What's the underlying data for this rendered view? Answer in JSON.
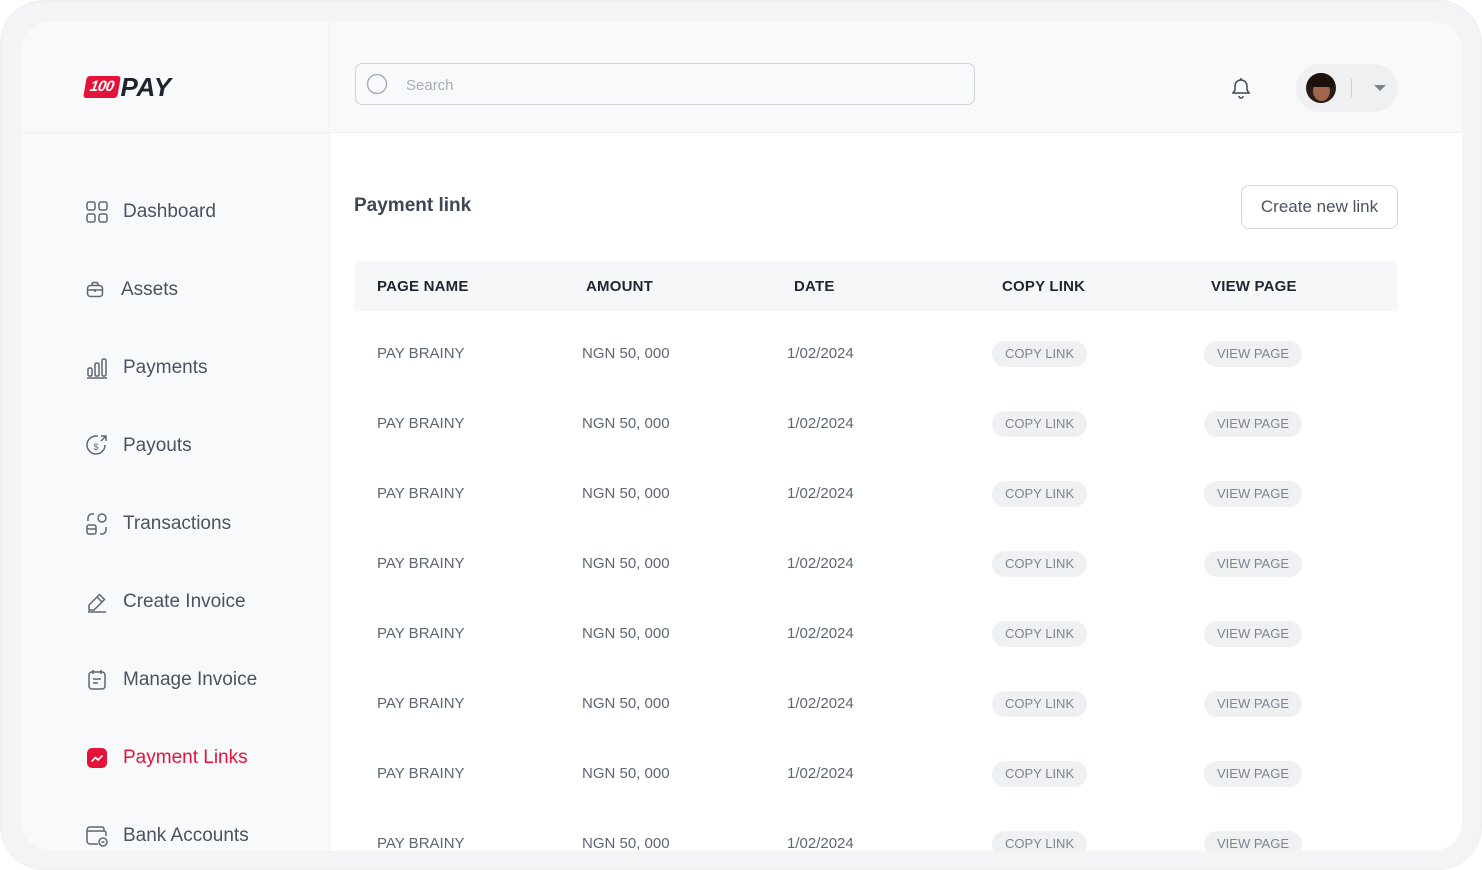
{
  "brand": {
    "badge": "100",
    "name": "PAY",
    "accent": "#e5133a"
  },
  "search": {
    "placeholder": "Search",
    "value": ""
  },
  "sidebar": {
    "items": [
      {
        "label": "Dashboard",
        "icon": "grid-icon",
        "active": false
      },
      {
        "label": "Assets",
        "icon": "briefcase-icon",
        "active": false
      },
      {
        "label": "Payments",
        "icon": "bar-chart-icon",
        "active": false
      },
      {
        "label": "Payouts",
        "icon": "dollar-circle-icon",
        "active": false
      },
      {
        "label": "Transactions",
        "icon": "transactions-icon",
        "active": false
      },
      {
        "label": "Create Invoice",
        "icon": "pen-icon",
        "active": false
      },
      {
        "label": "Manage Invoice",
        "icon": "clipboard-icon",
        "active": false
      },
      {
        "label": "Payment Links",
        "icon": "trend-icon",
        "active": true
      },
      {
        "label": "Bank Accounts",
        "icon": "wallet-icon",
        "active": false
      }
    ]
  },
  "main": {
    "title": "Payment link",
    "create_button": "Create new link",
    "table": {
      "headers": [
        "PAGE NAME",
        "AMOUNT",
        "DATE",
        "COPY LINK",
        "VIEW PAGE"
      ],
      "rows": [
        {
          "name": "PAY BRAINY",
          "amount": "NGN 50, 000",
          "date": "1/02/2024",
          "copy": "COPY LINK",
          "view": "VIEW PAGE"
        },
        {
          "name": "PAY BRAINY",
          "amount": "NGN 50, 000",
          "date": "1/02/2024",
          "copy": "COPY LINK",
          "view": "VIEW PAGE"
        },
        {
          "name": "PAY BRAINY",
          "amount": "NGN 50, 000",
          "date": "1/02/2024",
          "copy": "COPY LINK",
          "view": "VIEW PAGE"
        },
        {
          "name": "PAY BRAINY",
          "amount": "NGN 50, 000",
          "date": "1/02/2024",
          "copy": "COPY LINK",
          "view": "VIEW PAGE"
        },
        {
          "name": "PAY BRAINY",
          "amount": "NGN 50, 000",
          "date": "1/02/2024",
          "copy": "COPY LINK",
          "view": "VIEW PAGE"
        },
        {
          "name": "PAY BRAINY",
          "amount": "NGN 50, 000",
          "date": "1/02/2024",
          "copy": "COPY LINK",
          "view": "VIEW PAGE"
        },
        {
          "name": "PAY BRAINY",
          "amount": "NGN 50, 000",
          "date": "1/02/2024",
          "copy": "COPY LINK",
          "view": "VIEW PAGE"
        },
        {
          "name": "PAY BRAINY",
          "amount": "NGN 50, 000",
          "date": "1/02/2024",
          "copy": "COPY LINK",
          "view": "VIEW PAGE"
        }
      ]
    }
  }
}
